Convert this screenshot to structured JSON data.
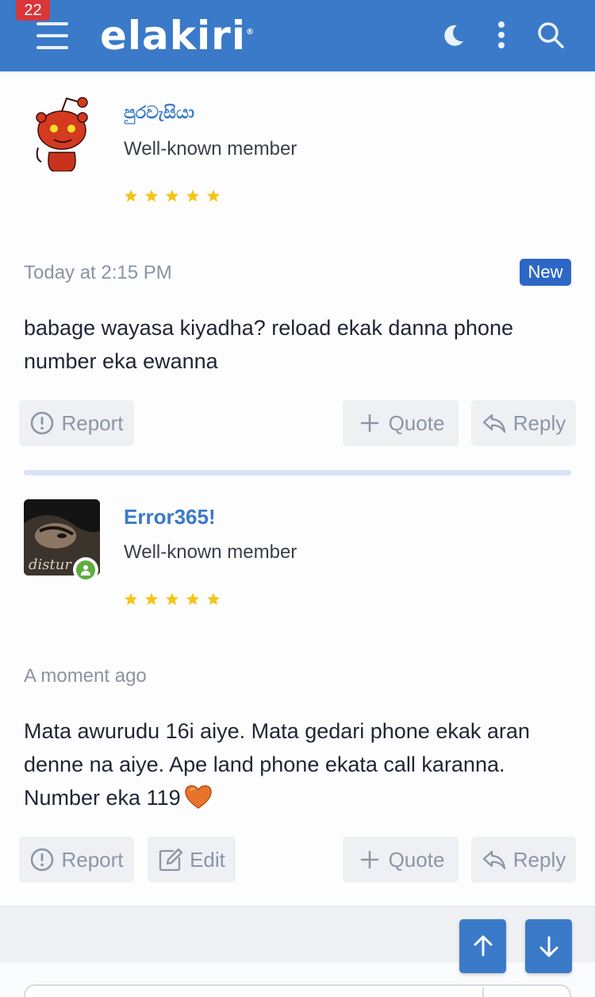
{
  "header": {
    "notification_count": "22",
    "logo_text": "elakiri",
    "logo_mark": "®",
    "icons": [
      "menu-icon",
      "moon-icon",
      "more-vertical-icon",
      "search-icon"
    ],
    "background_color": "#3a7ac8"
  },
  "posts": [
    {
      "username": "පුරවැසියා",
      "user_title": "Well-known member",
      "rating_stars": 5,
      "time": "Today at 2:15 PM",
      "badge": "New",
      "body": "babage wayasa kiyadha? reload ekak danna phone number eka ewanna",
      "actions": {
        "report": "Report",
        "quote": "Quote",
        "reply": "Reply"
      }
    },
    {
      "username": "Error365!",
      "user_title": "Well-known member",
      "rating_stars": 5,
      "time": "A moment ago",
      "body": "Mata awurudu 16i aiye. Mata gedari phone ekak aran denne na aiye. Ape land phone ekata call karanna. Number eka 119",
      "body_emoji": "orange-heart-icon",
      "avatar_text": "distur",
      "online": true,
      "actions": {
        "report": "Report",
        "edit": "Edit",
        "quote": "Quote",
        "reply": "Reply"
      }
    }
  ],
  "scroll_buttons": [
    "arrow-up-icon",
    "arrow-down-icon"
  ],
  "colors": {
    "accent": "#3a7ac8",
    "new_badge": "#2d67c6",
    "star": "#f5c518",
    "online": "#5fad41"
  }
}
